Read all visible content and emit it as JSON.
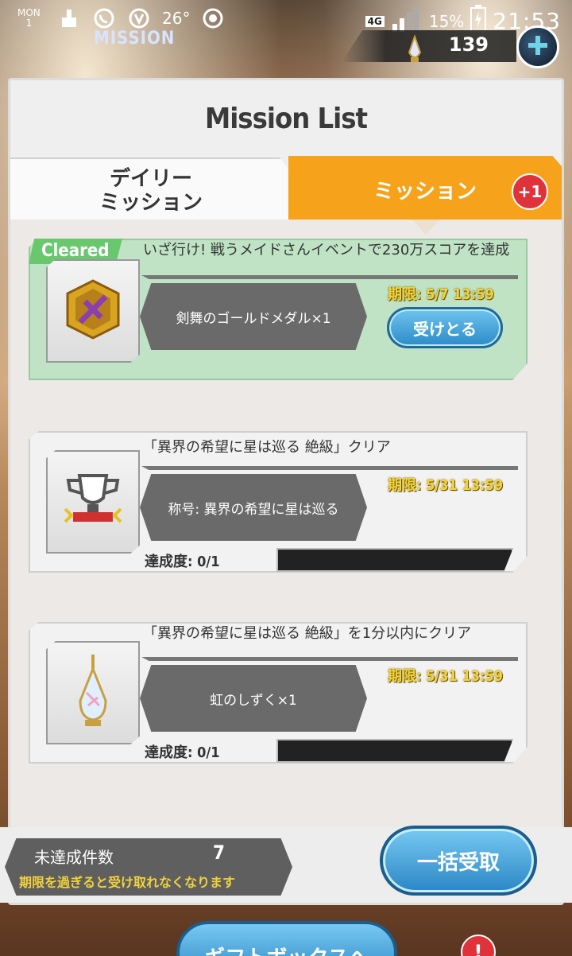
{
  "status_bar": {
    "day": "MON",
    "date": "1",
    "temperature": "26°",
    "network": "4G",
    "battery": "15%",
    "time": "21:53"
  },
  "header": {
    "title": "MISSION",
    "currency_value": "139"
  },
  "panel": {
    "title": "Mission List",
    "tabs": [
      {
        "label": "デイリー\nミッション",
        "active": false
      },
      {
        "label": "ミッション",
        "active": true,
        "badge": "+1"
      }
    ]
  },
  "missions": [
    {
      "status": "Cleared",
      "title": "いざ行け! 戦うメイドさんイベントで230万スコアを達成",
      "reward": "剣舞のゴールドメダル×1",
      "deadline": "期限: 5/7 13:59",
      "action": "受けとる",
      "icon": "gold-medal-icon"
    },
    {
      "title": "「異界の希望に星は巡る 絶級」クリア",
      "reward": "称号: 異界の希望に星は巡る",
      "deadline": "期限: 5/31 13:59",
      "progress_label": "達成度: 0/1",
      "progress": 0,
      "icon": "trophy-icon"
    },
    {
      "title": "「異界の希望に星は巡る 絶級」を1分以内にクリア",
      "reward": "虹のしずく×1",
      "deadline": "期限: 5/31 13:59",
      "progress_label": "達成度: 0/1",
      "progress": 0,
      "icon": "rainbow-drop-icon"
    }
  ],
  "footer": {
    "unachieved_label": "未達成件数",
    "unachieved_count": "7",
    "note": "期限を過ぎると受け取れなくなります",
    "claim_all": "一括受取",
    "gift_box": "ギフトボックスへ",
    "gift_badge": "!"
  },
  "colors": {
    "accent": "#f6a21b",
    "cleared": "#bfe3c4",
    "button_blue": "#2b8cc8",
    "badge_red": "#e0323a",
    "deadline_yellow": "#f3d33a"
  }
}
